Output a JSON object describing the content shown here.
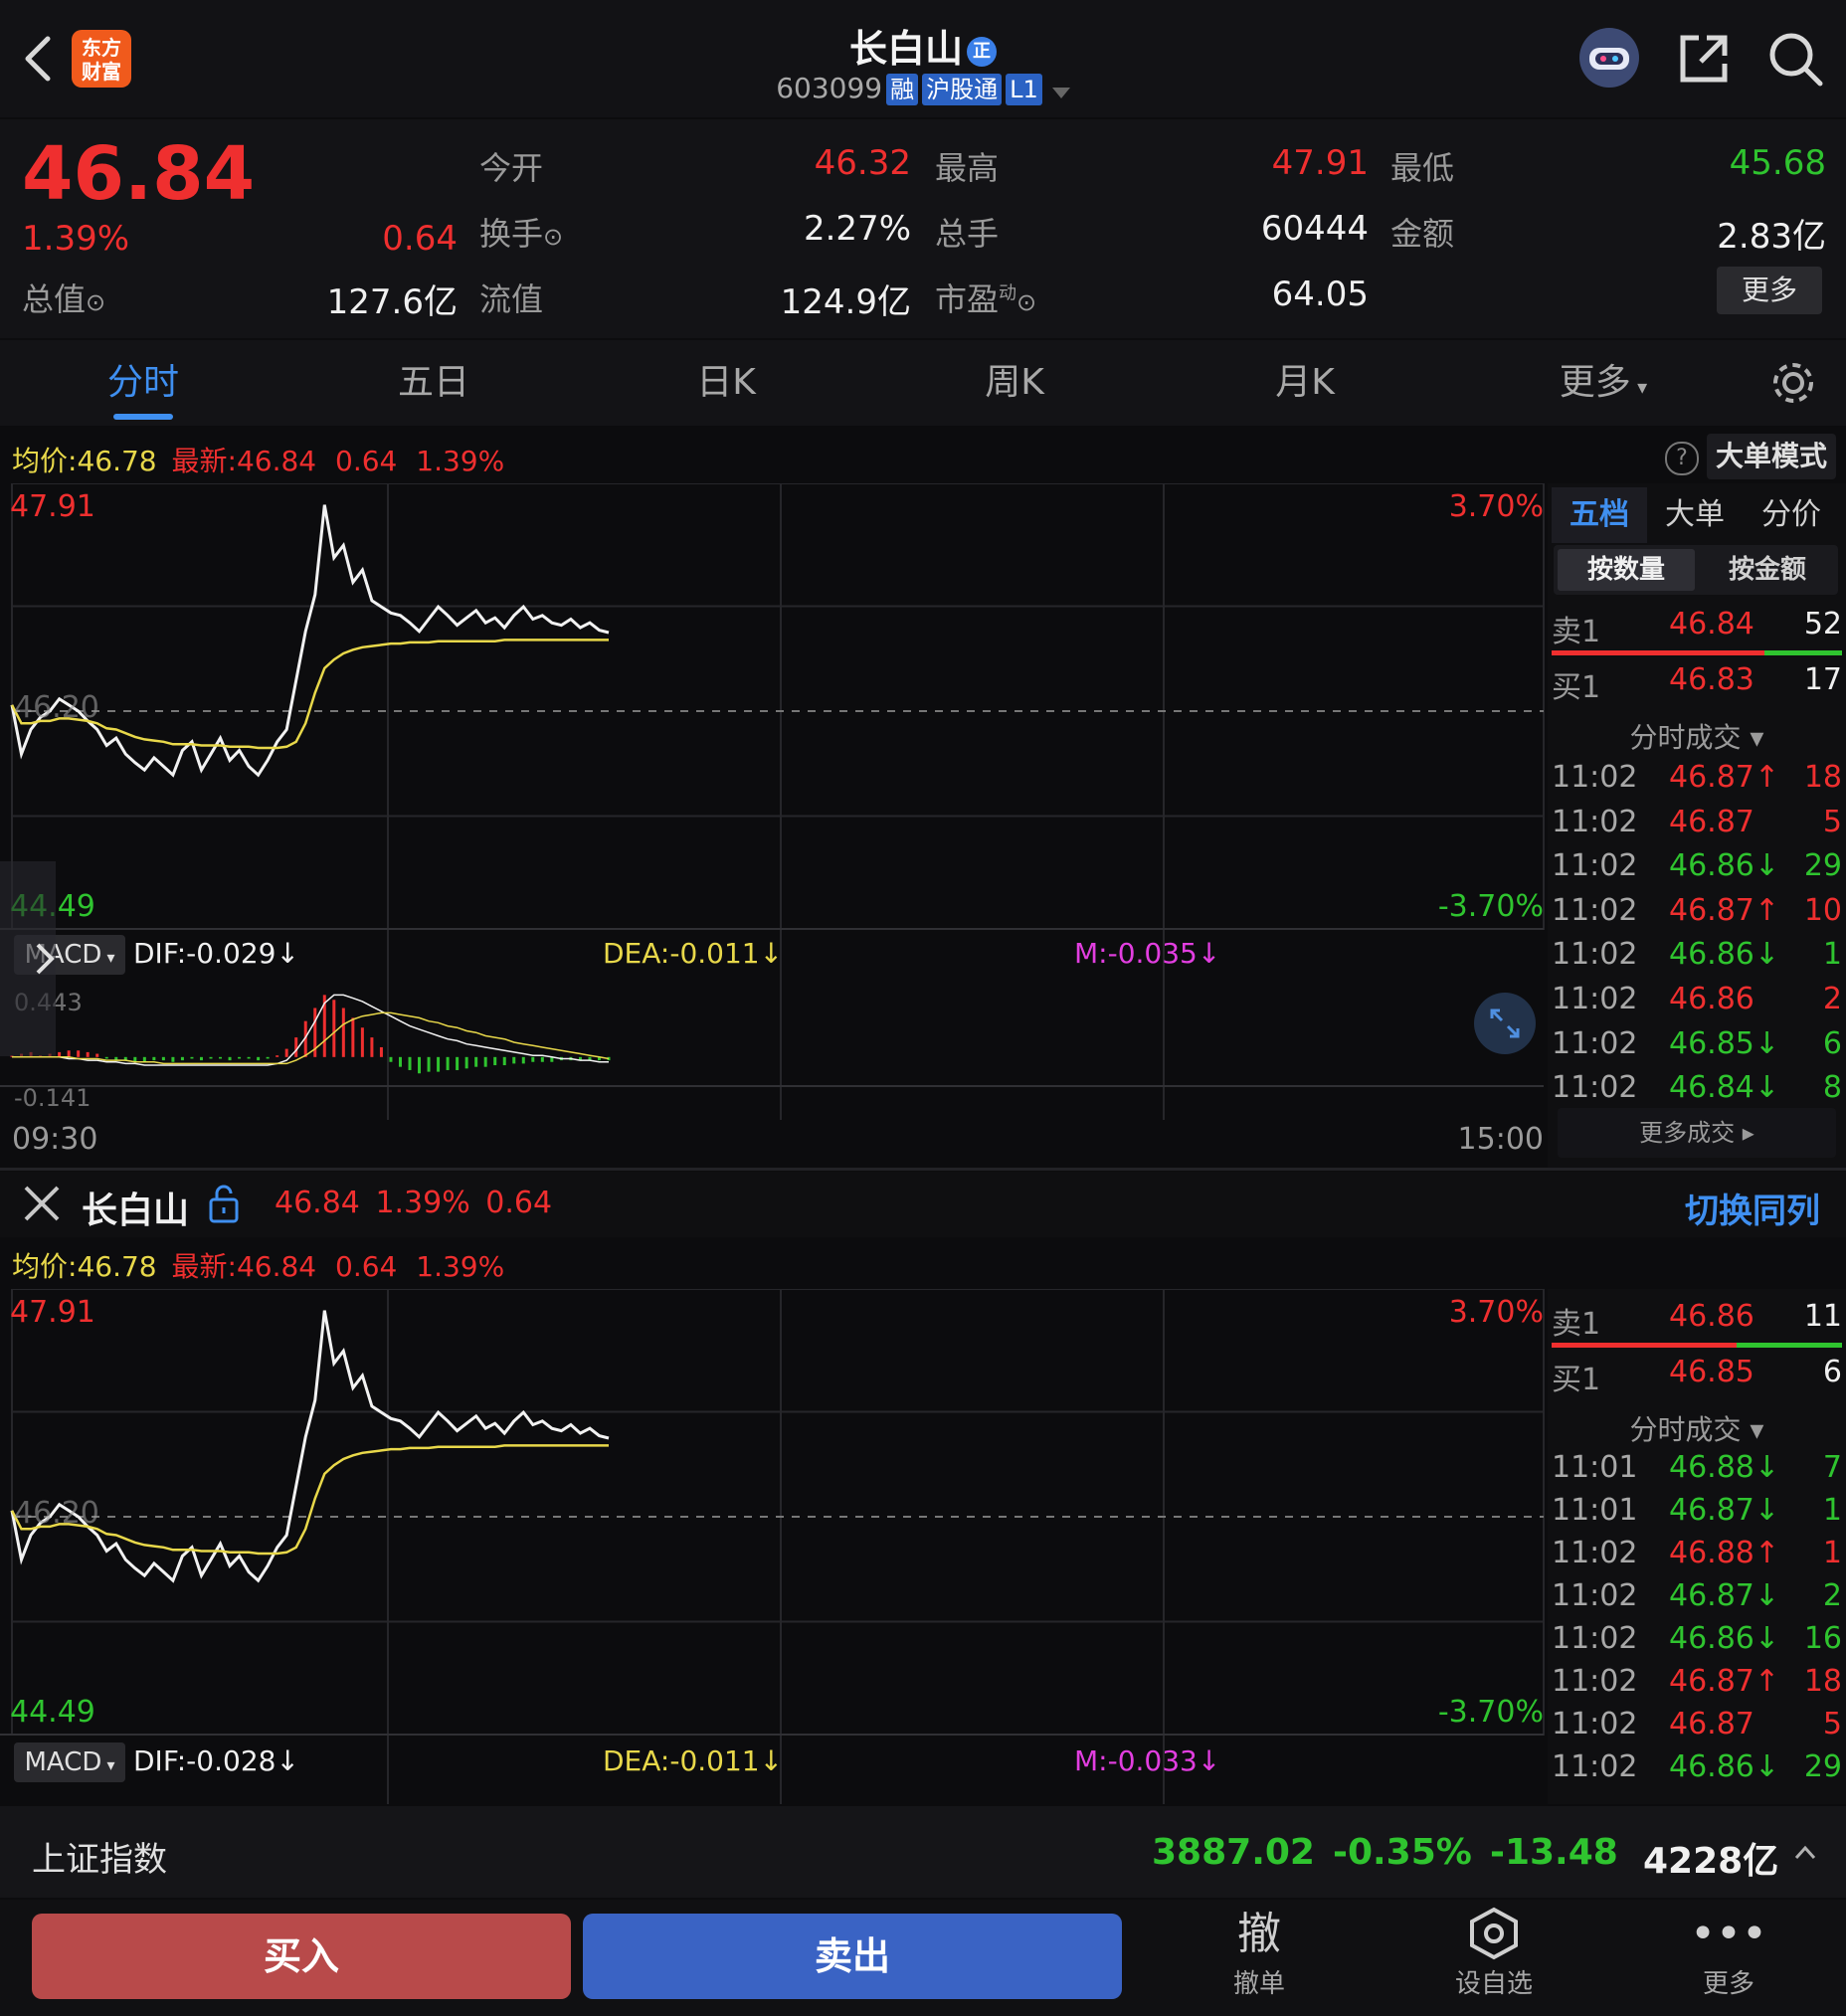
{
  "header": {
    "title": "长白山",
    "title_badge": "正",
    "code": "603099",
    "tags": [
      "融",
      "沪股通",
      "L1"
    ],
    "logo_text_1": "东方",
    "logo_text_2": "财富"
  },
  "quote": {
    "price": "46.84",
    "change_pct": "1.39%",
    "change": "0.64",
    "total_value_label": "总值",
    "total_value": "127.6亿",
    "open_label": "今开",
    "open": "46.32",
    "high_label": "最高",
    "high": "47.91",
    "low_label": "最低",
    "low": "45.68",
    "turnover_label": "换手",
    "turnover": "2.27%",
    "volume_label": "总手",
    "volume": "60444",
    "amount_label": "金额",
    "amount": "2.83亿",
    "float_label": "流值",
    "float": "124.9亿",
    "pe_label": "市盈",
    "pe_sup": "动",
    "pe": "64.05",
    "more": "更多"
  },
  "tabs": [
    "分时",
    "五日",
    "日K",
    "周K",
    "月K",
    "更多"
  ],
  "chart1": {
    "avg_label": "均价:",
    "avg": "46.78",
    "latest_label": "最新:",
    "latest": "46.84",
    "change": "0.64",
    "change_pct": "1.39%",
    "big_order_mode": "大单模式",
    "high_price": "47.91",
    "low_price": "44.49",
    "mid_price": "46.20",
    "high_pct": "3.70%",
    "low_pct": "-3.70%",
    "macd_label": "MACD",
    "dif": "DIF:-0.029",
    "dea": "DEA:-0.011",
    "m": "M:-0.035",
    "macd_top": "0.443",
    "macd_bottom": "-0.141",
    "time_start": "09:30",
    "time_end": "15:00"
  },
  "orderbook1": {
    "tabs": [
      "五档",
      "大单",
      "分价"
    ],
    "mode_tabs": [
      "按数量",
      "按金额"
    ],
    "sell": {
      "label": "卖1",
      "price": "46.84",
      "qty": "52"
    },
    "buy": {
      "label": "买1",
      "price": "46.83",
      "qty": "17"
    },
    "trades_title": "分时成交",
    "trades": [
      {
        "time": "11:02",
        "price": "46.87↑",
        "qty": "18",
        "dir": "up"
      },
      {
        "time": "11:02",
        "price": "46.87",
        "qty": "5",
        "dir": "flat"
      },
      {
        "time": "11:02",
        "price": "46.86↓",
        "qty": "29",
        "dir": "down"
      },
      {
        "time": "11:02",
        "price": "46.87↑",
        "qty": "10",
        "dir": "up"
      },
      {
        "time": "11:02",
        "price": "46.86↓",
        "qty": "1",
        "dir": "down"
      },
      {
        "time": "11:02",
        "price": "46.86",
        "qty": "2",
        "dir": "flat"
      },
      {
        "time": "11:02",
        "price": "46.85↓",
        "qty": "6",
        "dir": "down"
      },
      {
        "time": "11:02",
        "price": "46.84↓",
        "qty": "8",
        "dir": "down"
      }
    ],
    "more_trades": "更多成交"
  },
  "compare": {
    "name": "长白山",
    "price": "46.84",
    "change_pct": "1.39%",
    "change": "0.64",
    "switch": "切换同列"
  },
  "chart2": {
    "avg_label": "均价:",
    "avg": "46.78",
    "latest_label": "最新:",
    "latest": "46.84",
    "change": "0.64",
    "change_pct": "1.39%",
    "high_price": "47.91",
    "low_price": "44.49",
    "mid_price": "46.20",
    "high_pct": "3.70%",
    "low_pct": "-3.70%",
    "macd_label": "MACD",
    "dif": "DIF:-0.028",
    "dea": "DEA:-0.011",
    "m": "M:-0.033"
  },
  "orderbook2": {
    "sell": {
      "label": "卖1",
      "price": "46.86",
      "qty": "11"
    },
    "buy": {
      "label": "买1",
      "price": "46.85",
      "qty": "6"
    },
    "trades_title": "分时成交",
    "trades": [
      {
        "time": "11:01",
        "price": "46.88↓",
        "qty": "7",
        "dir": "down"
      },
      {
        "time": "11:01",
        "price": "46.87↓",
        "qty": "1",
        "dir": "down"
      },
      {
        "time": "11:02",
        "price": "46.88↑",
        "qty": "1",
        "dir": "up"
      },
      {
        "time": "11:02",
        "price": "46.87↓",
        "qty": "2",
        "dir": "down"
      },
      {
        "time": "11:02",
        "price": "46.86↓",
        "qty": "16",
        "dir": "down"
      },
      {
        "time": "11:02",
        "price": "46.87↑",
        "qty": "18",
        "dir": "up"
      },
      {
        "time": "11:02",
        "price": "46.87",
        "qty": "5",
        "dir": "flat"
      },
      {
        "time": "11:02",
        "price": "46.86↓",
        "qty": "29",
        "dir": "down"
      }
    ]
  },
  "index_bar": {
    "name": "上证指数",
    "value": "3887.02",
    "change_pct": "-0.35%",
    "change": "-13.48",
    "amount": "4228亿"
  },
  "actions": {
    "buy": "买入",
    "sell": "卖出",
    "cancel_glyph": "撤",
    "cancel": "撤单",
    "watch": "设自选",
    "more": "更多"
  },
  "colors": {
    "up": "#ef2f2f",
    "down": "#2fc42f",
    "accent": "#3f8ff0",
    "avg_line": "#e8d84a"
  },
  "intraday": {
    "price_range": [
      44.49,
      47.91
    ],
    "prices": [
      46.25,
      45.85,
      46.05,
      46.15,
      46.2,
      46.3,
      46.25,
      46.2,
      46.12,
      46.05,
      45.92,
      45.98,
      45.85,
      45.78,
      45.72,
      45.82,
      45.75,
      45.68,
      45.88,
      45.95,
      45.72,
      45.85,
      45.98,
      45.8,
      45.88,
      45.75,
      45.68,
      45.8,
      45.95,
      46.05,
      46.45,
      46.85,
      47.15,
      47.88,
      47.45,
      47.55,
      47.25,
      47.35,
      47.1,
      47.05,
      47.0,
      46.98,
      46.92,
      46.85,
      46.95,
      47.05,
      46.98,
      46.9,
      46.96,
      47.02,
      46.92,
      46.96,
      46.88,
      46.98,
      47.05,
      46.95,
      46.98,
      46.92,
      46.9,
      46.95,
      46.88,
      46.92,
      46.86,
      46.84
    ],
    "avg_prices": [
      46.25,
      46.1,
      46.1,
      46.12,
      46.12,
      46.14,
      46.14,
      46.13,
      46.12,
      46.1,
      46.06,
      46.05,
      46.02,
      45.99,
      45.97,
      45.96,
      45.95,
      45.93,
      45.93,
      45.93,
      45.92,
      45.92,
      45.92,
      45.91,
      45.91,
      45.91,
      45.9,
      45.9,
      45.9,
      45.91,
      45.95,
      46.1,
      46.35,
      46.55,
      46.62,
      46.67,
      46.7,
      46.72,
      46.73,
      46.74,
      46.75,
      46.75,
      46.76,
      46.76,
      46.76,
      46.77,
      46.77,
      46.77,
      46.77,
      46.77,
      46.77,
      46.77,
      46.78,
      46.78,
      46.78,
      46.78,
      46.78,
      46.78,
      46.78,
      46.78,
      46.78,
      46.78,
      46.78,
      46.78
    ],
    "macd_range": [
      -0.141,
      0.443
    ],
    "macd_hist": [
      0.01,
      0.02,
      0.03,
      0.01,
      0.02,
      0.03,
      0.04,
      0.04,
      0.03,
      0.02,
      -0.01,
      -0.02,
      -0.02,
      -0.03,
      -0.03,
      -0.02,
      -0.02,
      -0.03,
      -0.02,
      -0.01,
      -0.02,
      -0.01,
      -0.01,
      -0.02,
      -0.01,
      -0.01,
      -0.02,
      -0.01,
      0.01,
      0.05,
      0.12,
      0.22,
      0.3,
      0.38,
      0.35,
      0.3,
      0.24,
      0.18,
      0.12,
      0.06,
      -0.03,
      -0.06,
      -0.08,
      -0.1,
      -0.09,
      -0.09,
      -0.08,
      -0.08,
      -0.07,
      -0.06,
      -0.06,
      -0.05,
      -0.05,
      -0.04,
      -0.04,
      -0.03,
      -0.03,
      -0.03,
      -0.02,
      -0.02,
      -0.02,
      -0.02,
      -0.02,
      -0.02
    ],
    "macd_dif": [
      0.0,
      0.0,
      0.0,
      0.0,
      0.0,
      0.0,
      -0.01,
      -0.01,
      -0.02,
      -0.02,
      -0.03,
      -0.03,
      -0.04,
      -0.04,
      -0.05,
      -0.05,
      -0.05,
      -0.05,
      -0.05,
      -0.05,
      -0.05,
      -0.05,
      -0.05,
      -0.05,
      -0.05,
      -0.05,
      -0.05,
      -0.05,
      -0.04,
      -0.02,
      0.04,
      0.12,
      0.22,
      0.33,
      0.38,
      0.38,
      0.36,
      0.34,
      0.31,
      0.28,
      0.25,
      0.22,
      0.19,
      0.17,
      0.15,
      0.13,
      0.11,
      0.1,
      0.08,
      0.07,
      0.06,
      0.05,
      0.04,
      0.03,
      0.02,
      0.01,
      0.01,
      0.0,
      -0.01,
      -0.01,
      -0.02,
      -0.02,
      -0.03,
      -0.03
    ],
    "macd_dea": [
      0.0,
      0.0,
      0.0,
      0.0,
      0.0,
      0.0,
      0.0,
      -0.01,
      -0.01,
      -0.01,
      -0.02,
      -0.02,
      -0.02,
      -0.03,
      -0.03,
      -0.03,
      -0.04,
      -0.04,
      -0.04,
      -0.04,
      -0.04,
      -0.04,
      -0.04,
      -0.04,
      -0.04,
      -0.04,
      -0.04,
      -0.04,
      -0.04,
      -0.04,
      -0.02,
      0.01,
      0.05,
      0.1,
      0.15,
      0.2,
      0.23,
      0.25,
      0.26,
      0.27,
      0.27,
      0.26,
      0.25,
      0.24,
      0.22,
      0.21,
      0.19,
      0.18,
      0.16,
      0.15,
      0.13,
      0.12,
      0.11,
      0.09,
      0.08,
      0.07,
      0.06,
      0.05,
      0.04,
      0.03,
      0.02,
      0.01,
      0.0,
      -0.01
    ]
  }
}
